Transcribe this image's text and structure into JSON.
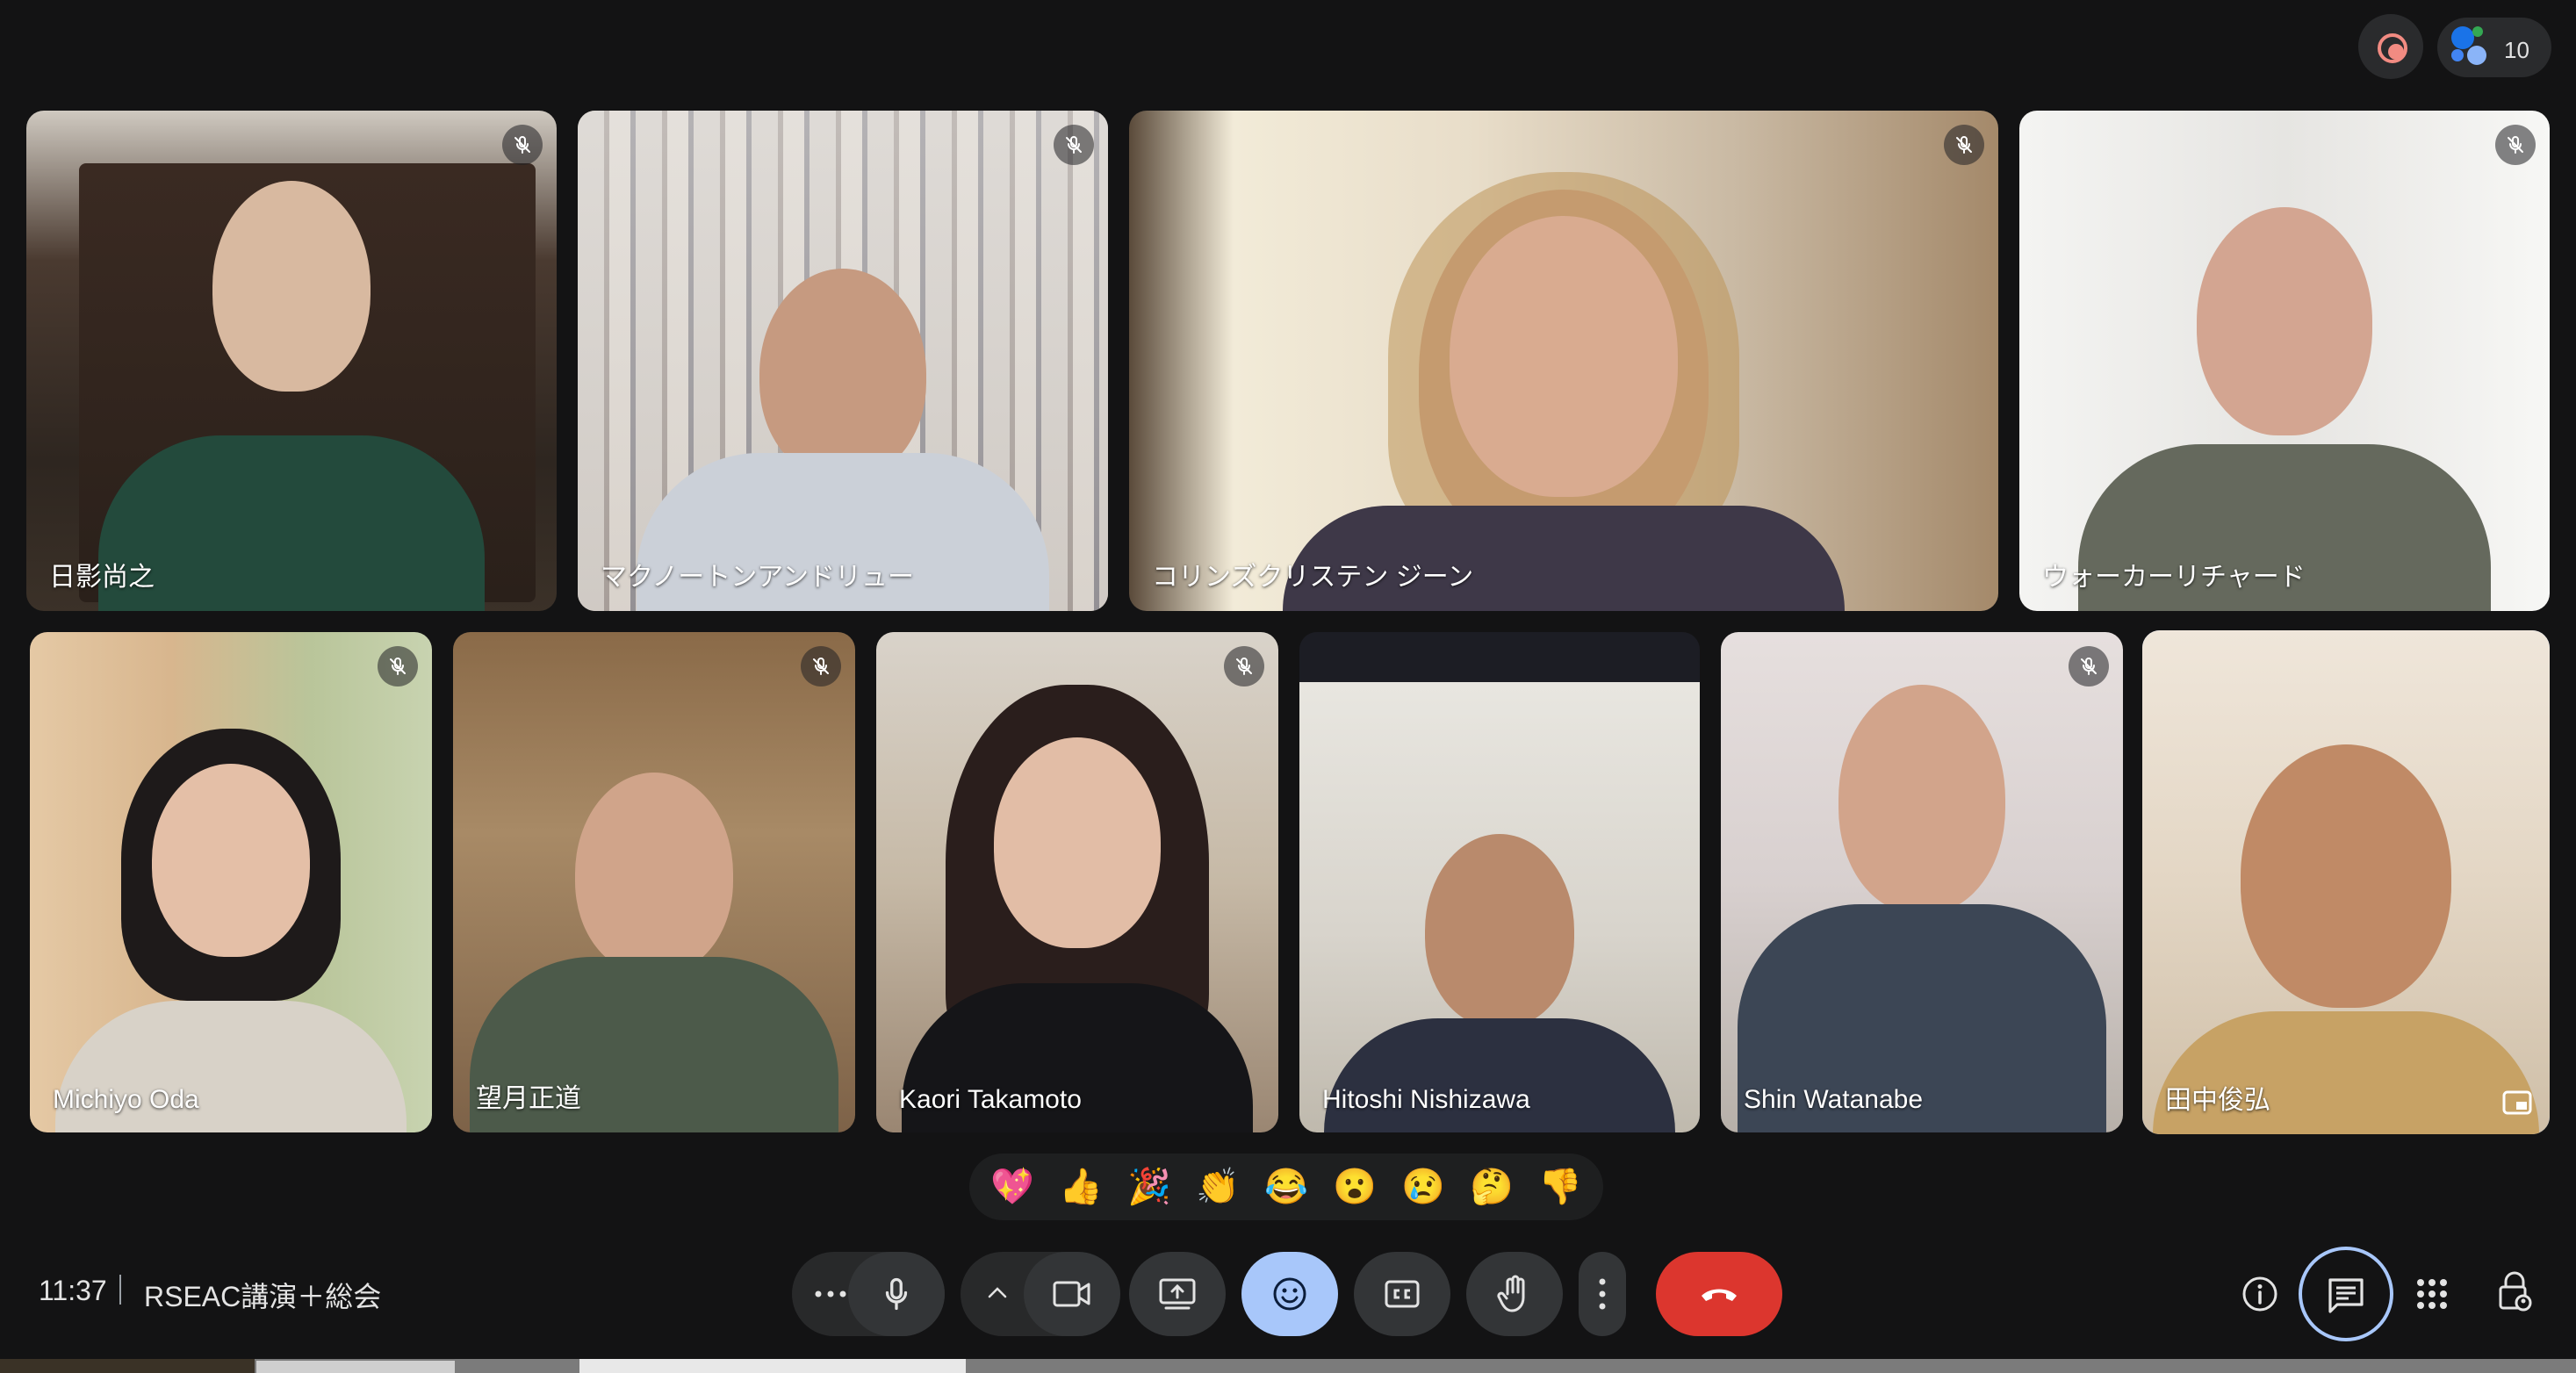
{
  "top": {
    "recording_icon": "record-icon",
    "participants_count": "10"
  },
  "participants": [
    {
      "name": "日影尚之",
      "muted": true
    },
    {
      "name": "マクノートンアンドリュー",
      "muted": true
    },
    {
      "name": "コリンズクリステン ジーン",
      "muted": true
    },
    {
      "name": "ウォーカーリチャード",
      "muted": true
    },
    {
      "name": "Michiyo Oda",
      "muted": true
    },
    {
      "name": "望月正道",
      "muted": true
    },
    {
      "name": "Kaori Takamoto",
      "muted": true
    },
    {
      "name": "Hitoshi Nishizawa",
      "muted": false
    },
    {
      "name": "Shin Watanabe",
      "muted": true
    },
    {
      "name": "田中俊弘",
      "muted": false,
      "active": true
    }
  ],
  "reactions": [
    "💖",
    "👍",
    "🎉",
    "👏",
    "😂",
    "😮",
    "😢",
    "🤔",
    "👎"
  ],
  "bottom": {
    "time": "11:37",
    "meeting_title": "RSEAC講演＋総会"
  },
  "controls": [
    "more-options-icon",
    "microphone-icon",
    "chevron-up-icon",
    "camera-icon",
    "present-screen-icon",
    "emoji-icon",
    "captions-icon",
    "raise-hand-icon",
    "more-vert-icon",
    "end-call-icon"
  ],
  "right_controls": [
    "info-icon",
    "chat-icon",
    "apps-grid-icon",
    "host-controls-icon"
  ],
  "colors": {
    "background": "#131314",
    "accent_blue": "#a8c7fa",
    "end_call_red": "#dc362e",
    "record_red": "#f28b82"
  }
}
